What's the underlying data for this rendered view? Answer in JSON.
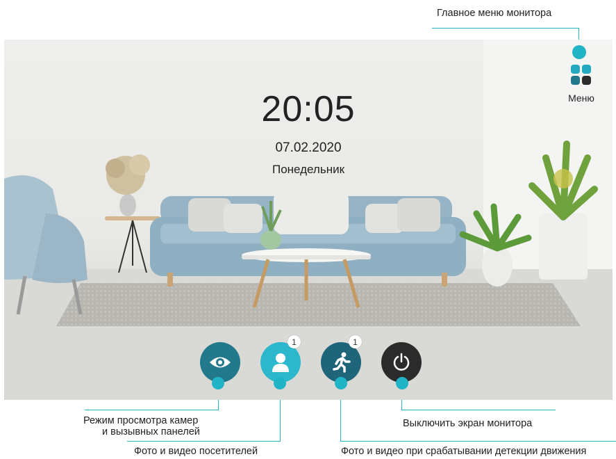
{
  "annotations": {
    "main_menu": "Главное меню монитора",
    "camera_view": [
      "Режим просмотра камер",
      "и вызывных панелей"
    ],
    "visitors": "Фото и видео посетителей",
    "motion": "Фото и видео при срабатывании детекции движения",
    "screen_off": "Выключить экран монитора"
  },
  "screen": {
    "time": "20:05",
    "date": "07.02.2020",
    "weekday": "Понедельник",
    "menu_label": "Меню",
    "buttons": {
      "camera": {
        "icon": "eye-icon"
      },
      "visitors": {
        "icon": "person-icon",
        "badge": "1"
      },
      "motion": {
        "icon": "running-man-icon",
        "badge": "1"
      },
      "power": {
        "icon": "power-icon"
      }
    }
  },
  "colors": {
    "accent": "#21b4c7",
    "camera_button": "#23798c",
    "visitors_button": "#2cb7cc",
    "motion_button": "#1e6579",
    "power_button": "#2b2b2b"
  }
}
